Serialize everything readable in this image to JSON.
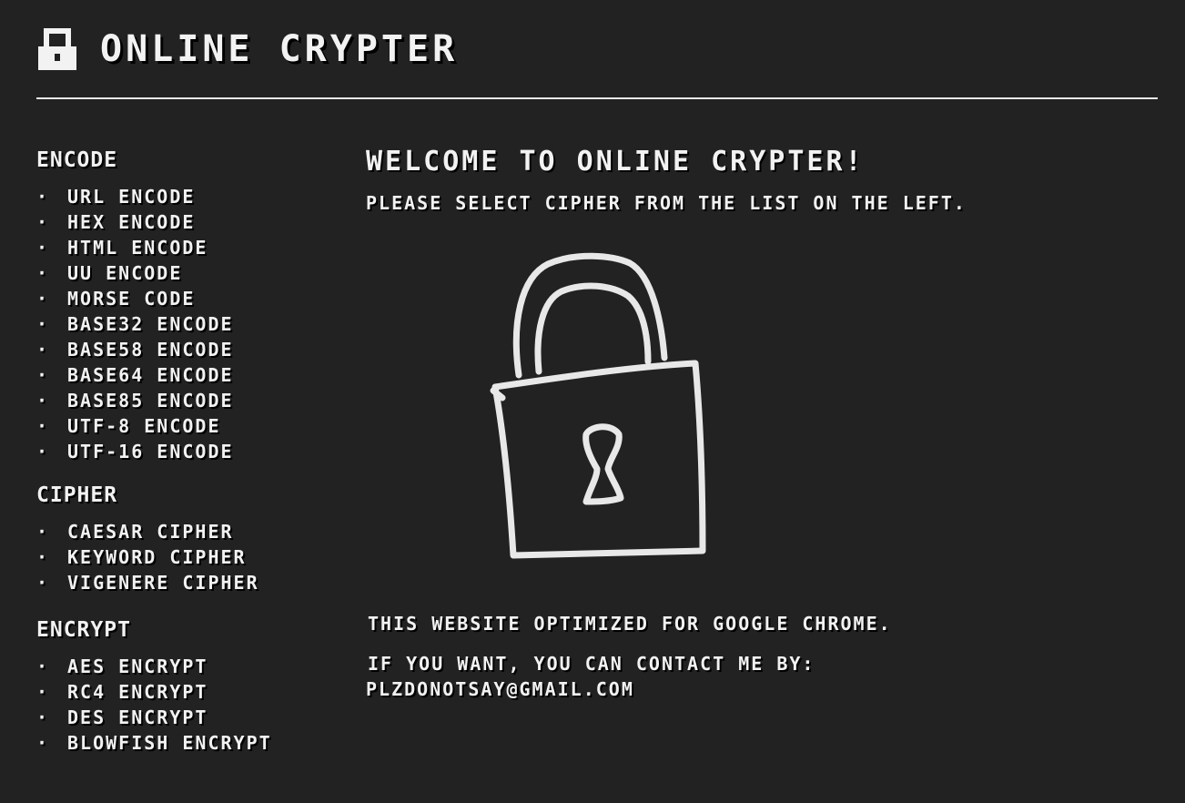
{
  "header": {
    "title": "ONLINE CRYPTER",
    "icon": "lock-icon"
  },
  "sidebar": {
    "sections": [
      {
        "title": "ENCODE",
        "items": [
          "URL ENCODE",
          "HEX ENCODE",
          "HTML ENCODE",
          "UU ENCODE",
          "MORSE CODE",
          "BASE32 ENCODE",
          "BASE58 ENCODE",
          "BASE64 ENCODE",
          "BASE85 ENCODE",
          "UTF-8 ENCODE",
          "UTF-16 ENCODE"
        ]
      },
      {
        "title": "CIPHER",
        "items": [
          "CAESAR CIPHER",
          "KEYWORD CIPHER",
          "VIGENERE CIPHER"
        ]
      },
      {
        "title": "ENCRYPT",
        "items": [
          "AES ENCRYPT",
          "RC4 ENCRYPT",
          "DES ENCRYPT",
          "BLOWFISH ENCRYPT"
        ]
      }
    ],
    "bullet": "·"
  },
  "main": {
    "welcome": "WELCOME TO ONLINE CRYPTER!",
    "select_msg": "PLEASE SELECT CIPHER FROM THE LIST ON THE LEFT.",
    "illustration_icon": "padlock-drawing",
    "chrome_msg": "THIS WEBSITE OPTIMIZED FOR GOOGLE CHROME.",
    "contact_msg": "IF YOU WANT, YOU CAN CONTACT ME BY:",
    "contact_email": "PLZDONOTSAY@GMAIL.COM"
  },
  "colors": {
    "background": "#222222",
    "text": "#f2f2f2",
    "shadow": "#000000"
  }
}
